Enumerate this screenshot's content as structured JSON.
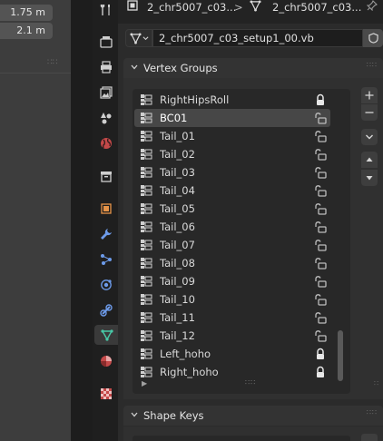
{
  "viewport": {
    "field1": "1.75 m",
    "field2": "2.1 m"
  },
  "property_tabs": [
    {
      "name": "tool-tab",
      "icon": "wrench-screwdriver-icon"
    },
    {
      "name": "render-tab",
      "icon": "camera-back-icon"
    },
    {
      "name": "output-tab",
      "icon": "printer-icon"
    },
    {
      "name": "view-layer-tab",
      "icon": "image-stack-icon"
    },
    {
      "name": "scene-tab",
      "icon": "scene-cone-sphere-icon"
    },
    {
      "name": "world-tab",
      "icon": "globe-icon"
    },
    {
      "name": "collection-tab",
      "icon": "box-icon"
    },
    {
      "name": "object-tab",
      "icon": "object-square-icon"
    },
    {
      "name": "modifiers-tab",
      "icon": "wrench-icon"
    },
    {
      "name": "particles-tab",
      "icon": "particles-icon"
    },
    {
      "name": "physics-tab",
      "icon": "physics-orbit-icon"
    },
    {
      "name": "constraints-tab",
      "icon": "constraint-icon"
    },
    {
      "name": "data-tab",
      "icon": "mesh-vertices-icon",
      "active": true
    },
    {
      "name": "material-tab",
      "icon": "material-sphere-icon"
    },
    {
      "name": "texture-tab",
      "icon": "checker-icon"
    }
  ],
  "header": {
    "object_name": "2_chr5007_c03...",
    "data_name": "2_chr5007_c03...",
    "separator": ">"
  },
  "data_block": {
    "name": "2_chr5007_c03_setup1_00.vb"
  },
  "vertex_groups": {
    "title": "Vertex Groups",
    "items": [
      {
        "label": "RightHipsRoll",
        "locked": true,
        "selected": false
      },
      {
        "label": "BC01",
        "locked": false,
        "selected": true
      },
      {
        "label": "Tail_01",
        "locked": false,
        "selected": false
      },
      {
        "label": "Tail_02",
        "locked": false,
        "selected": false
      },
      {
        "label": "Tail_03",
        "locked": false,
        "selected": false
      },
      {
        "label": "Tail_04",
        "locked": false,
        "selected": false
      },
      {
        "label": "Tail_05",
        "locked": false,
        "selected": false
      },
      {
        "label": "Tail_06",
        "locked": false,
        "selected": false
      },
      {
        "label": "Tail_07",
        "locked": false,
        "selected": false
      },
      {
        "label": "Tail_08",
        "locked": false,
        "selected": false
      },
      {
        "label": "Tail_09",
        "locked": false,
        "selected": false
      },
      {
        "label": "Tail_10",
        "locked": false,
        "selected": false
      },
      {
        "label": "Tail_11",
        "locked": false,
        "selected": false
      },
      {
        "label": "Tail_12",
        "locked": false,
        "selected": false
      },
      {
        "label": "Left_hoho",
        "locked": true,
        "selected": false
      },
      {
        "label": "Right_hoho",
        "locked": true,
        "selected": false
      }
    ],
    "buttons": {
      "add": "+",
      "remove": "−"
    }
  },
  "shape_keys": {
    "title": "Shape Keys"
  },
  "colors": {
    "accent_mesh": "#48c9a8",
    "selected_row": "#474747"
  }
}
